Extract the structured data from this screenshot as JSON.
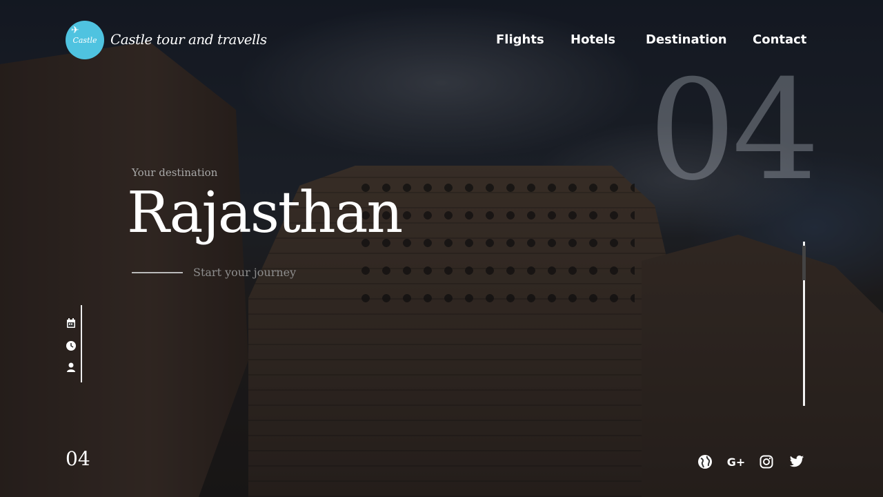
{
  "header": {
    "brand": "Castle tour and travells",
    "logo_text": "Castle",
    "nav": [
      "Flights",
      "Hotels",
      "Destination",
      "Contact"
    ]
  },
  "hero": {
    "slide_number_large": "04",
    "subtitle": "Your destination",
    "title": "Rajasthan",
    "cta": "Start your journey"
  },
  "side_icons": [
    "calendar-icon",
    "clock-icon",
    "user-icon"
  ],
  "footer": {
    "slide_number": "04",
    "social_icons": [
      "globe-icon",
      "google-plus-icon",
      "instagram-icon",
      "twitter-icon"
    ],
    "google_plus_label": "G+"
  },
  "colors": {
    "logo_bg": "#4fc3e0",
    "text": "#ffffff"
  }
}
